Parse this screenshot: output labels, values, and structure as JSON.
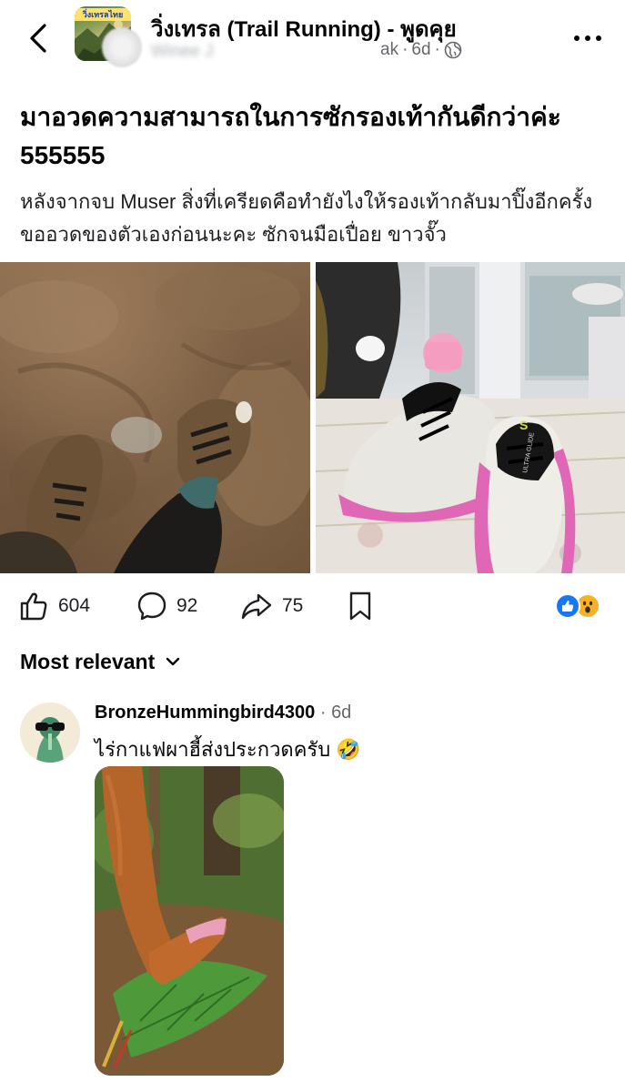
{
  "header": {
    "group_name": "วิ่งเทรล (Trail Running) - พูดคุย",
    "group_thumb_label": "วิ่งเทรลไทย",
    "author_name": "Winee J",
    "author_name_visible_tail": "ak",
    "timestamp": "6d",
    "privacy_icon": "globe-icon"
  },
  "post": {
    "title": "มาอวดความสามารถในการซักรองเท้ากันดีกว่าค่ะ 555555",
    "body": "หลังจากจบ Muser สิ่งที่เครียดคือทำยังไงให้รองเท้ากลับมาปิ๊งอีกครั้ง ขออวดของตัวเองก่อนนะคะ ซักจนมือเปื่อย ขาวจั๊ว",
    "photos": [
      {
        "name": "muddy-shoes-photo"
      },
      {
        "name": "clean-shoes-photo",
        "shoe_brand_text": "S",
        "tongue_text": "ULTRA GLIDE"
      }
    ]
  },
  "actions": {
    "like_count": "604",
    "comment_count": "92",
    "share_count": "75",
    "reactions": [
      "like",
      "wow"
    ],
    "colors": {
      "like_blue": "#1877f2",
      "wow_yellow": "#f7b125"
    }
  },
  "comments": {
    "sort_label": "Most relevant",
    "items": [
      {
        "author": "BronzeHummingbird4300",
        "separator": "·",
        "time": "6d",
        "text": "ไร่กาแฟผาฮี้ส่งประกวดครับ 🤣"
      }
    ]
  }
}
